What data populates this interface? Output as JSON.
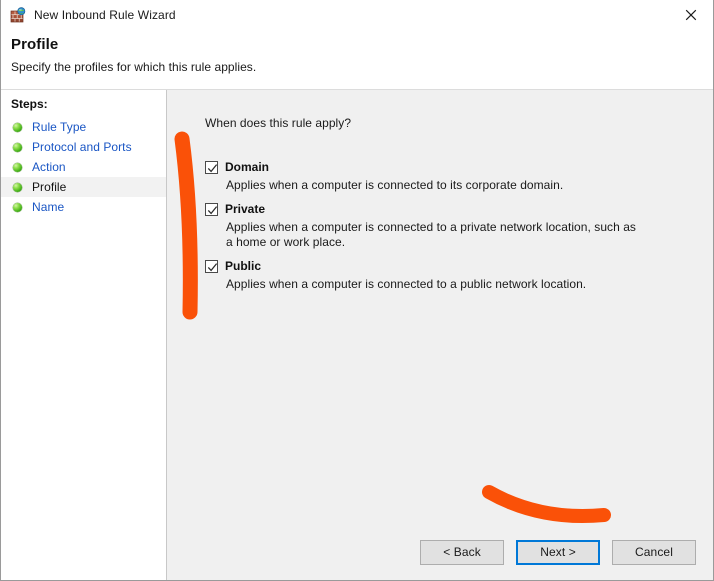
{
  "window": {
    "title": "New Inbound Rule Wizard",
    "icon": "firewall-globe-icon",
    "close_label": "✕"
  },
  "header": {
    "title": "Profile",
    "subtitle": "Specify the profiles for which this rule applies."
  },
  "sidebar": {
    "heading": "Steps:",
    "items": [
      {
        "label": "Rule Type",
        "selected": false
      },
      {
        "label": "Protocol and Ports",
        "selected": false
      },
      {
        "label": "Action",
        "selected": false
      },
      {
        "label": "Profile",
        "selected": true
      },
      {
        "label": "Name",
        "selected": false
      }
    ]
  },
  "main": {
    "question": "When does this rule apply?",
    "profiles": [
      {
        "label": "Domain",
        "checked": true,
        "description": "Applies when a computer is connected to its corporate domain."
      },
      {
        "label": "Private",
        "checked": true,
        "description": "Applies when a computer is connected to a private network location, such as a home or work place."
      },
      {
        "label": "Public",
        "checked": true,
        "description": "Applies when a computer is connected to a public network location."
      }
    ]
  },
  "buttons": {
    "back": "< Back",
    "next": "Next >",
    "cancel": "Cancel"
  },
  "colors": {
    "accent_link": "#1a56c4",
    "focus_border": "#0078d7",
    "annotation_orange": "#fa4b00",
    "panel_gray": "#f0f0f0",
    "button_face": "#e1e1e1"
  },
  "annotations": [
    {
      "name": "vertical-stroke-left-of-checkboxes",
      "shape": "stroke"
    },
    {
      "name": "curved-underline-above-buttons",
      "shape": "stroke"
    }
  ]
}
